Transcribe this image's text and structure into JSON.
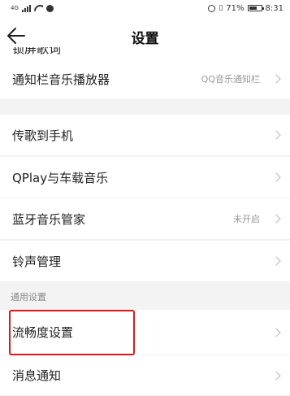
{
  "status_bar": {
    "network": "4G",
    "battery_text": "71%",
    "time": "8:31",
    "battery_level": 0.71
  },
  "header": {
    "title": "设置",
    "back_icon": "arrow-left-icon"
  },
  "partial_item": {
    "label": "锁屏歌词"
  },
  "items": [
    {
      "label": "通知栏音乐播放器",
      "value": "QQ音乐通知栏"
    },
    {
      "label": "传歌到手机",
      "value": ""
    },
    {
      "label": "QPlay与车载音乐",
      "value": ""
    },
    {
      "label": "蓝牙音乐管家",
      "value": "未开启"
    },
    {
      "label": "铃声管理",
      "value": ""
    }
  ],
  "section_header": "通用设置",
  "general_items": [
    {
      "label": "流畅度设置",
      "value": ""
    },
    {
      "label": "消息通知",
      "value": ""
    }
  ],
  "highlight_color": "#e8141a"
}
